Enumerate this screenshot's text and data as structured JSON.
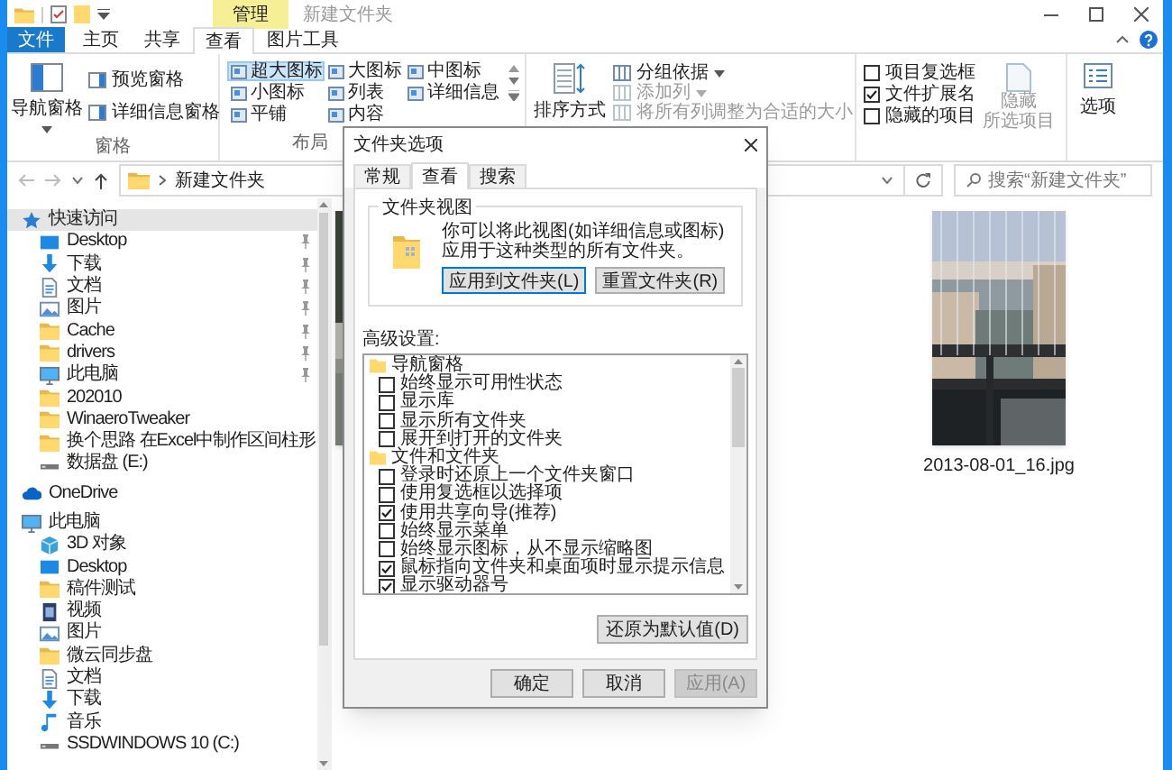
{
  "title_bar": {
    "context_tab": "管理",
    "title": "新建文件夹"
  },
  "ribbon_tabs": [
    {
      "label": "文件",
      "kind": "file",
      "selected": false
    },
    {
      "label": "主页",
      "kind": "tab",
      "selected": false
    },
    {
      "label": "共享",
      "kind": "tab",
      "selected": false
    },
    {
      "label": "查看",
      "kind": "tab",
      "selected": true
    },
    {
      "label": "图片工具",
      "kind": "tab",
      "selected": false
    }
  ],
  "ribbon": {
    "panes": {
      "navigation_pane": "导航窗格",
      "preview_pane": "预览窗格",
      "details_pane": "详细信息窗格",
      "label": "窗格"
    },
    "layout": {
      "label": "布局",
      "items": [
        {
          "label": "超大图标",
          "selected": true
        },
        {
          "label": "大图标",
          "selected": false
        },
        {
          "label": "中图标",
          "selected": false
        },
        {
          "label": "小图标",
          "selected": false
        },
        {
          "label": "列表",
          "selected": false
        },
        {
          "label": "详细信息",
          "selected": false
        },
        {
          "label": "平铺",
          "selected": false
        },
        {
          "label": "内容",
          "selected": false
        }
      ]
    },
    "current_view": {
      "sort": "排序方式",
      "items": [
        {
          "label": "分组依据",
          "disabled": false,
          "dropdown": true
        },
        {
          "label": "添加列",
          "disabled": true,
          "dropdown": true
        },
        {
          "label": "将所有列调整为合适的大小",
          "disabled": true,
          "dropdown": false
        }
      ]
    },
    "show_hide": {
      "checkboxes": [
        {
          "label": "项目复选框",
          "checked": false
        },
        {
          "label": "文件扩展名",
          "checked": true
        },
        {
          "label": "隐藏的项目",
          "checked": false
        }
      ],
      "hide_selected": {
        "lines": [
          "隐藏",
          "所选项目"
        ],
        "disabled": true
      }
    },
    "options": "选项"
  },
  "address": {
    "path": "新建文件夹",
    "search_placeholder": "搜索“新建文件夹”"
  },
  "nav": [
    {
      "label": "快速访问",
      "kind": "star",
      "selected": true,
      "children": [
        {
          "label": "Desktop",
          "kind": "desktop",
          "selected": false,
          "pinned": true
        },
        {
          "label": "下载",
          "kind": "download",
          "selected": false,
          "pinned": true
        },
        {
          "label": "文档",
          "kind": "document",
          "selected": false,
          "pinned": true
        },
        {
          "label": "图片",
          "kind": "picture",
          "selected": false,
          "pinned": true
        },
        {
          "label": "Cache",
          "kind": "folder",
          "selected": false,
          "pinned": true
        },
        {
          "label": "drivers",
          "kind": "folder",
          "selected": false,
          "pinned": true
        },
        {
          "label": "此电脑",
          "kind": "pc",
          "selected": false,
          "pinned": true
        },
        {
          "label": "202010",
          "kind": "folder",
          "selected": false,
          "pinned": false
        },
        {
          "label": "WinaeroTweaker",
          "kind": "folder",
          "selected": false,
          "pinned": false
        },
        {
          "label": "换个思路 在Excel中制作区间柱形",
          "kind": "folder",
          "selected": false,
          "pinned": false
        },
        {
          "label": "数据盘 (E:)",
          "kind": "drive",
          "selected": false,
          "pinned": false
        }
      ]
    },
    {
      "label": "OneDrive",
      "kind": "cloud",
      "selected": false
    },
    {
      "label": "此电脑",
      "kind": "pc",
      "selected": false,
      "children": [
        {
          "label": "3D 对象",
          "kind": "cube",
          "selected": false
        },
        {
          "label": "Desktop",
          "kind": "desktop",
          "selected": false
        },
        {
          "label": "稿件测试",
          "kind": "folder",
          "selected": false
        },
        {
          "label": "视频",
          "kind": "video",
          "selected": false
        },
        {
          "label": "图片",
          "kind": "picture",
          "selected": false
        },
        {
          "label": "微云同步盘",
          "kind": "folder",
          "selected": false
        },
        {
          "label": "文档",
          "kind": "document",
          "selected": false
        },
        {
          "label": "下载",
          "kind": "download",
          "selected": false
        },
        {
          "label": "音乐",
          "kind": "music",
          "selected": false
        },
        {
          "label": "SSDWINDOWS 10 (C:)",
          "kind": "drive",
          "selected": false
        }
      ]
    }
  ],
  "files": [
    {
      "kind": "picture"
    },
    {
      "kind": "picture",
      "name": "2013-08-01_16.jpg"
    }
  ],
  "dialog": {
    "title": "文件夹选项",
    "tabs": [
      {
        "label": "常规",
        "selected": false
      },
      {
        "label": "查看",
        "selected": true
      },
      {
        "label": "搜索",
        "selected": false
      }
    ],
    "folder_views": {
      "legend": "文件夹视图",
      "description": "你可以将此视图(如详细信息或图标)应用于这种类型的所有文件夹。",
      "buttons": [
        {
          "label": "应用到文件夹(L)",
          "focused": true
        },
        {
          "label": "重置文件夹(R)",
          "focused": false
        }
      ]
    },
    "advanced_label": "高级设置:",
    "settings": [
      {
        "kind": "group",
        "label": "导航窗格"
      },
      {
        "kind": "checkbox",
        "label": "始终显示可用性状态",
        "checked": false
      },
      {
        "kind": "checkbox",
        "label": "显示库",
        "checked": false
      },
      {
        "kind": "checkbox",
        "label": "显示所有文件夹",
        "checked": false
      },
      {
        "kind": "checkbox",
        "label": "展开到打开的文件夹",
        "checked": false
      },
      {
        "kind": "group",
        "label": "文件和文件夹"
      },
      {
        "kind": "checkbox",
        "label": "登录时还原上一个文件夹窗口",
        "checked": false
      },
      {
        "kind": "checkbox",
        "label": "使用复选框以选择项",
        "checked": false
      },
      {
        "kind": "checkbox",
        "label": "使用共享向导(推荐)",
        "checked": true
      },
      {
        "kind": "checkbox",
        "label": "始终显示菜单",
        "checked": false
      },
      {
        "kind": "checkbox",
        "label": "始终显示图标，从不显示缩略图",
        "checked": false
      },
      {
        "kind": "checkbox",
        "label": "鼠标指向文件夹和桌面项时显示提示信息",
        "checked": true
      },
      {
        "kind": "checkbox",
        "label": "显示驱动器号",
        "checked": true
      }
    ],
    "restore_button": "还原为默认值(D)",
    "buttons": [
      {
        "label": "确定",
        "disabled": false
      },
      {
        "label": "取消",
        "disabled": false
      },
      {
        "label": "应用(A)",
        "disabled": true
      }
    ]
  }
}
